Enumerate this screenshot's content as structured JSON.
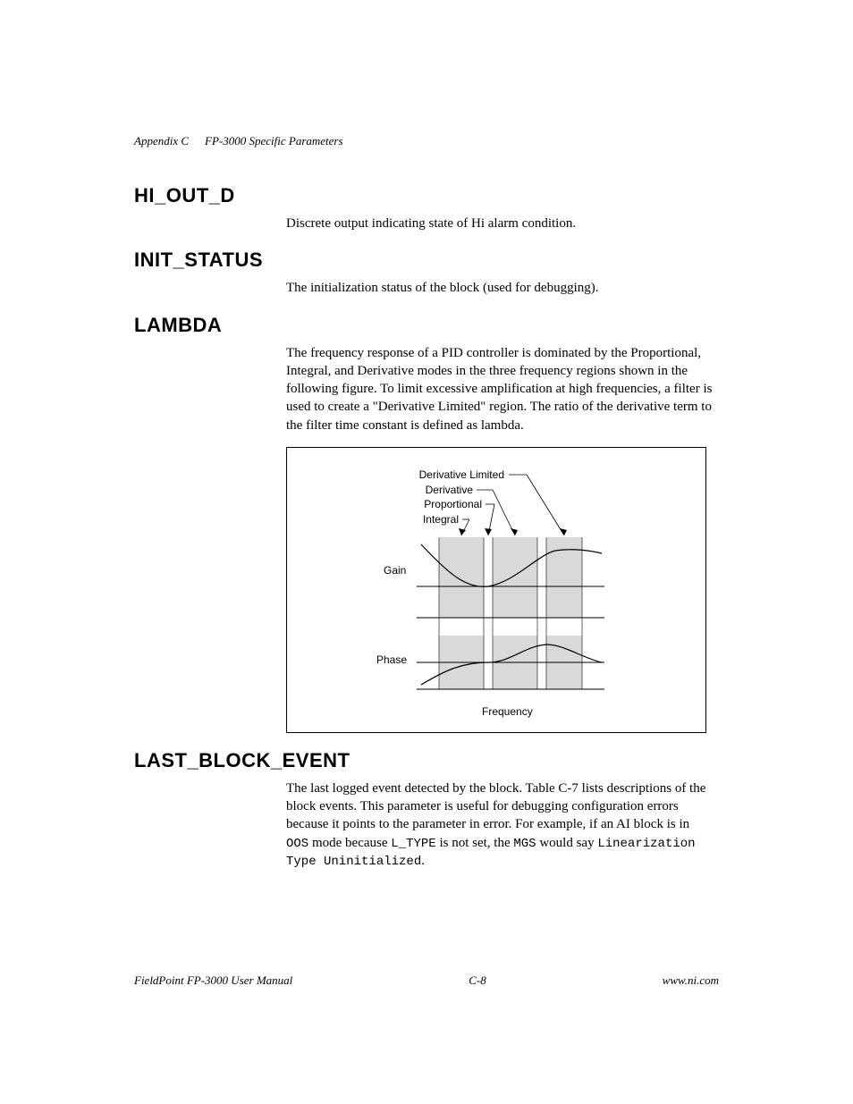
{
  "header": {
    "appendix": "Appendix C",
    "title": "FP-3000 Specific Parameters"
  },
  "sections": {
    "hi_out_d": {
      "heading": "HI_OUT_D",
      "body": "Discrete output indicating state of Hi alarm condition."
    },
    "init_status": {
      "heading": "INIT_STATUS",
      "body": "The initialization status of the block (used for debugging)."
    },
    "lambda": {
      "heading": "LAMBDA",
      "body": "The frequency response of a PID controller is dominated by the Proportional, Integral, and Derivative modes in the three frequency regions shown in the following figure. To limit excessive amplification at high frequencies, a filter is used to create a \"Derivative Limited\" region. The ratio of the derivative term to the filter time constant is defined as lambda."
    },
    "last_block_event": {
      "heading": "LAST_BLOCK_EVENT",
      "body_pre": "The last logged event detected by the block. Table C-7 lists descriptions of the block events. This parameter is useful for debugging configuration errors because it points to the parameter in error. For example, if an AI block is in ",
      "code1": "OOS",
      "mid1": " mode because ",
      "code2": "L_TYPE",
      "mid2": " is not set, the ",
      "code3": "MGS",
      "mid3": " would say ",
      "code4": "Linearization Type Uninitialized",
      "end": "."
    }
  },
  "figure": {
    "labels": {
      "derivative_limited": "Derivative Limited",
      "derivative": "Derivative",
      "proportional": "Proportional",
      "integral": "Integral"
    },
    "axis": {
      "gain": "Gain",
      "phase": "Phase",
      "frequency": "Frequency"
    }
  },
  "footer": {
    "left": "FieldPoint FP-3000 User Manual",
    "center": "C-8",
    "right": "www.ni.com"
  }
}
